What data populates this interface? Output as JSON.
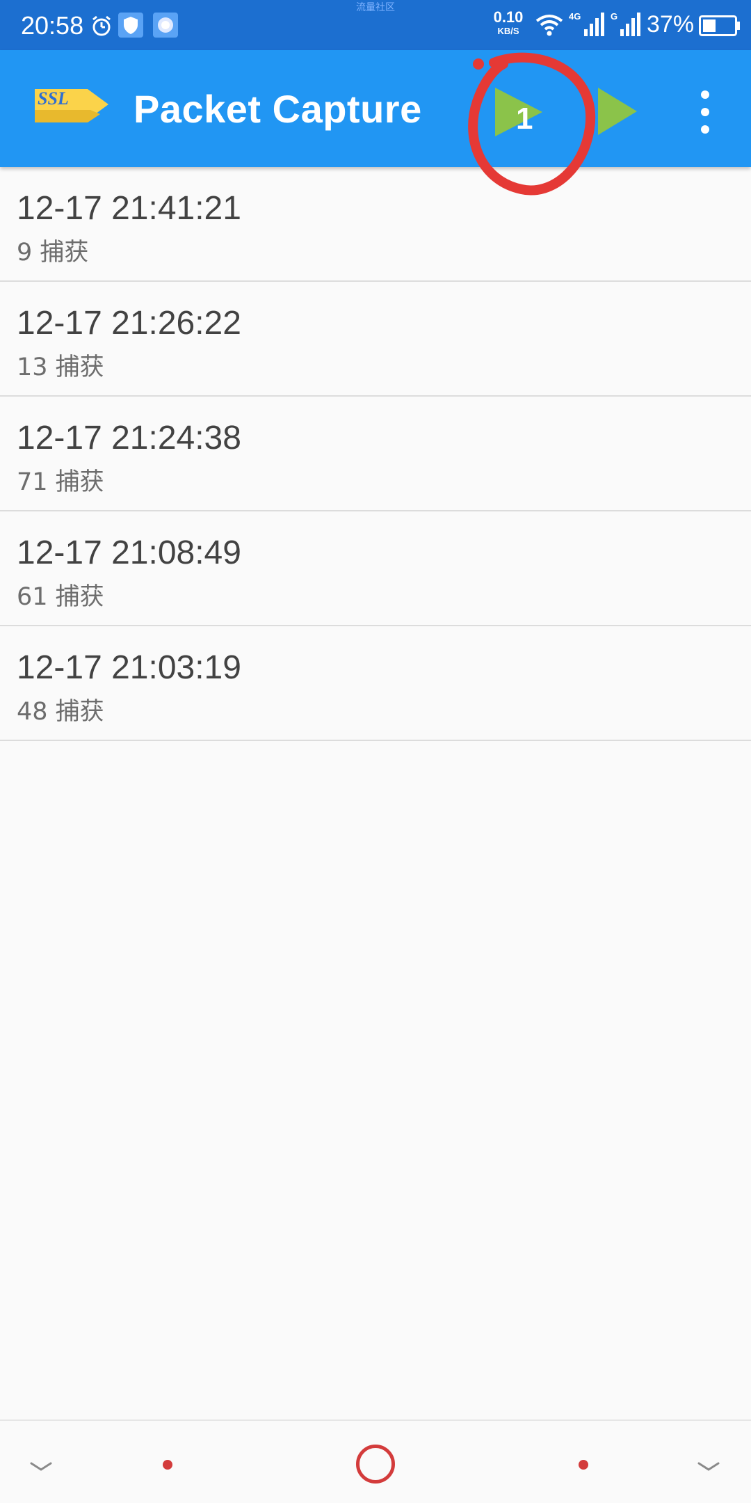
{
  "status_bar": {
    "time": "20:58",
    "watermark": "流量社区",
    "net_speed_value": "0.10",
    "net_speed_unit": "KB/S",
    "signal_1_label": "4G",
    "signal_2_label": "G",
    "battery_percent": "37%",
    "icons": [
      "alarm-icon",
      "shield-icon",
      "browser-icon",
      "wifi-icon",
      "signal-4g-icon",
      "signal-g-icon",
      "battery-icon"
    ]
  },
  "app_bar": {
    "logo_text": "SSL",
    "title": "Packet Capture",
    "badge_number": "1",
    "accent_color": "#2196f3",
    "play_icon_color": "#8bc34a",
    "annotation_color": "#e53935"
  },
  "captures": [
    {
      "time": "12-17 21:41:21",
      "count": "9 捕获"
    },
    {
      "time": "12-17 21:26:22",
      "count": "13 捕获"
    },
    {
      "time": "12-17 21:24:38",
      "count": "71 捕获"
    },
    {
      "time": "12-17 21:08:49",
      "count": "61 捕获"
    },
    {
      "time": "12-17 21:03:19",
      "count": "48 捕获"
    }
  ],
  "nav_bar": {
    "icons": [
      "chevron-down-icon",
      "dot-icon",
      "home-circle-icon",
      "dot-icon",
      "chevron-down-icon"
    ],
    "color": "#d33b3b"
  }
}
